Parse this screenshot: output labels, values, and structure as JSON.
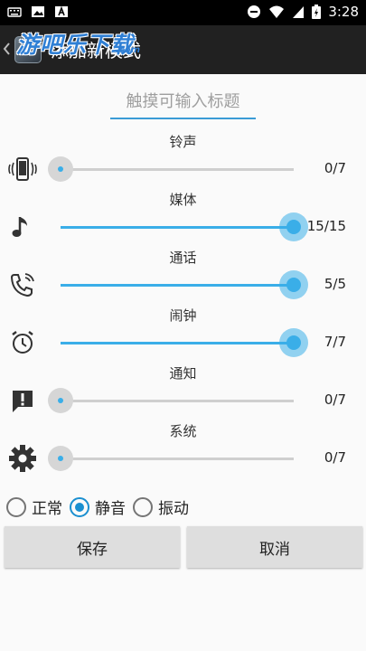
{
  "status_bar": {
    "time": "3:28",
    "left_icons": [
      "keyboard-icon",
      "image-icon",
      "text-a-icon"
    ],
    "right_icons": [
      "do-not-disturb-icon",
      "wifi-icon",
      "signal-icon",
      "battery-charging-icon"
    ]
  },
  "app_bar": {
    "title": "添加新模式",
    "back_icon": "chevron-left-icon",
    "watermark": "游吧乐下载",
    "watermark_sub": ".com"
  },
  "title_input": {
    "placeholder": "触摸可输入标题",
    "value": ""
  },
  "volumes": [
    {
      "label": "铃声",
      "icon": "phone-vibrate-icon",
      "value": 0,
      "max": 7,
      "display": "0/7"
    },
    {
      "label": "媒体",
      "icon": "music-note-icon",
      "value": 15,
      "max": 15,
      "display": "15/15"
    },
    {
      "label": "通话",
      "icon": "phone-in-talk-icon",
      "value": 5,
      "max": 5,
      "display": "5/5"
    },
    {
      "label": "闹钟",
      "icon": "alarm-clock-icon",
      "value": 7,
      "max": 7,
      "display": "7/7"
    },
    {
      "label": "通知",
      "icon": "notification-alert-icon",
      "value": 0,
      "max": 7,
      "display": "0/7"
    },
    {
      "label": "系统",
      "icon": "gear-icon",
      "value": 0,
      "max": 7,
      "display": "0/7"
    }
  ],
  "ringer_modes": {
    "options": [
      "正常",
      "静音",
      "振动"
    ],
    "selected": "静音"
  },
  "buttons": {
    "save": "保存",
    "cancel": "取消"
  },
  "colors": {
    "accent": "#3aaee8",
    "radio_checked": "#1a8fd0",
    "app_bar": "#212121"
  }
}
